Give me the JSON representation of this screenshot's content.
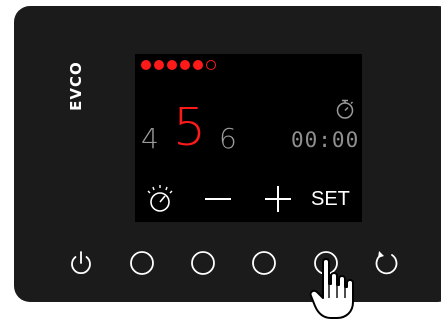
{
  "brand": {
    "logo_text": "EVCO"
  },
  "display": {
    "progress_dots": {
      "filled": 5,
      "total": 6
    },
    "value_prev": "4",
    "value_current": "5",
    "value_next": "6",
    "timer": "00:00",
    "timer_icon": "stopwatch-icon",
    "softkeys": {
      "gauge_icon": "gauge-icon",
      "minus_icon": "minus-icon",
      "plus_icon": "plus-icon",
      "set_label": "SET"
    }
  },
  "buttons": [
    {
      "icon": "power-icon"
    },
    {
      "icon": "circle-icon"
    },
    {
      "icon": "circle-icon"
    },
    {
      "icon": "circle-icon"
    },
    {
      "icon": "circle-icon"
    },
    {
      "icon": "refresh-icon"
    }
  ],
  "colors": {
    "accent": "#ff1a1a",
    "panel": "#1b1b1b",
    "screen": "#000000",
    "dim_text": "#9a9a9a"
  }
}
